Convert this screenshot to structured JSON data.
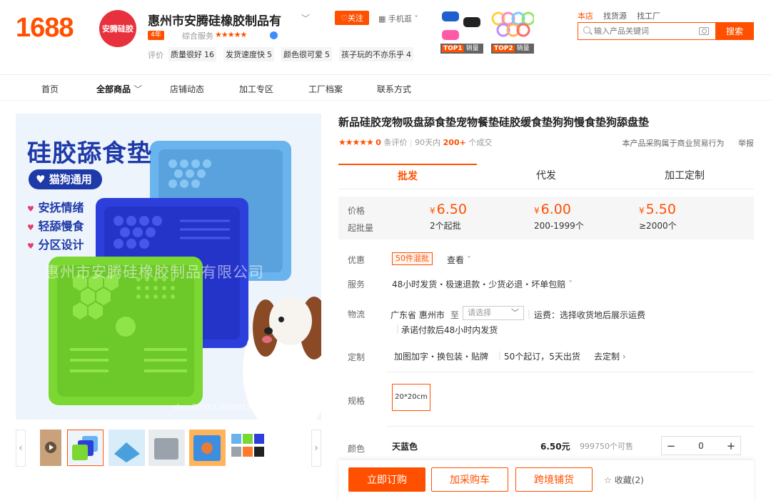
{
  "header": {
    "logo": "1688",
    "avatar_text": "安腾硅胶",
    "shop_name": "惠州市安腾硅橡胶制品有",
    "follow_label": "♡关注",
    "mobile_label": "手机逛",
    "years_badge": "4年",
    "score_label": "综合服务",
    "stars": "★★★★★",
    "eval_label": "评价",
    "eval_tags": [
      {
        "label": "质量很好",
        "count": "16"
      },
      {
        "label": "发货速度快",
        "count": "5"
      },
      {
        "label": "颜色很可爱",
        "count": "5"
      },
      {
        "label": "孩子玩的不亦乐乎",
        "count": "4"
      }
    ],
    "top_products": [
      {
        "rank": "TOP1",
        "tag": "销量"
      },
      {
        "rank": "TOP2",
        "tag": "销量"
      }
    ]
  },
  "search": {
    "tabs": [
      "本店",
      "找货源",
      "找工厂"
    ],
    "placeholder": "输入产品关键词",
    "button": "搜索"
  },
  "nav": [
    "首页",
    "全部商品",
    "店铺动态",
    "加工专区",
    "工厂档案",
    "联系方式"
  ],
  "gallery": {
    "headline": "硅胶舔食垫",
    "pill": "猫狗通用",
    "bullets": [
      "安抚情绪",
      "轻舔慢食",
      "分区设计"
    ],
    "watermark": "惠州市安腾硅橡胶制品有限公司",
    "url_watermark": "shop8092926099z3.1688.com"
  },
  "product": {
    "title": "新品硅胶宠物吸盘舔食垫宠物餐垫硅胶缓食垫狗狗慢食垫狗舔盘垫",
    "stars": "★★★★★",
    "review_count": "0",
    "review_label": "条评价",
    "period": "90天内",
    "sold": "200+",
    "sold_label": "个成交",
    "notice": "本产品采购属于商业贸易行为",
    "report": "举报"
  },
  "tabs": [
    "批发",
    "代发",
    "加工定制"
  ],
  "price": {
    "price_label": "价格",
    "moq_label": "起批量",
    "currency": "¥",
    "tiers": [
      {
        "price": "6.50",
        "qty": "2个起批"
      },
      {
        "price": "6.00",
        "qty": "200-1999个"
      },
      {
        "price": "5.50",
        "qty": "≥2000个"
      }
    ]
  },
  "details": {
    "promo_label": "优惠",
    "promo_tag": "50件混批",
    "promo_view": "查看",
    "service_label": "服务",
    "service_text": "48小时发货・极速退款・少货必退・坏单包赔",
    "logistics_label": "物流",
    "from": "广东省 惠州市",
    "to": "至",
    "select_placeholder": "请选择",
    "shipping_fee": "运费：选择收货地后展示运费",
    "ship_promise": "承诺付款后48小时内发货",
    "custom_label": "定制",
    "custom_text": "加图加字・换包装・贴牌",
    "custom_moq": "50个起订，5天出货",
    "custom_link": "去定制"
  },
  "spec": {
    "label": "规格",
    "option": "20*20cm"
  },
  "color": {
    "label": "颜色",
    "name": "天蓝色",
    "price": "6.50元",
    "stock": "999750个可售",
    "quantity": "0"
  },
  "actions": {
    "buy": "立即订购",
    "cart": "加采购车",
    "crossborder": "跨境铺货",
    "favorite": "收藏(2)"
  },
  "colors": {
    "brand": "#ff5000",
    "mat_blue": "#5aa9e6",
    "mat_navy": "#2c3fd6",
    "mat_green": "#7bd832"
  }
}
